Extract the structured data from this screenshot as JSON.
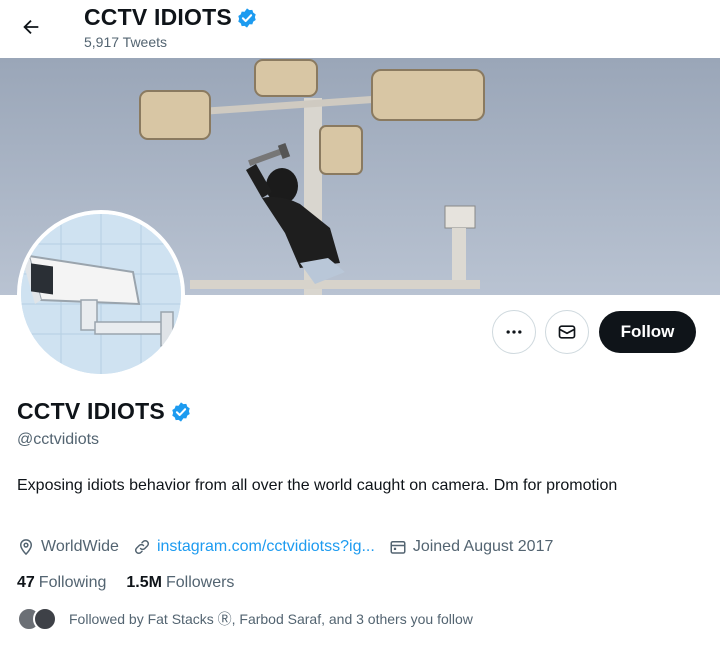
{
  "header": {
    "title": "CCTV IDIOTS",
    "tweets_count": "5,917 Tweets"
  },
  "profile": {
    "name": "CCTV IDIOTS",
    "handle": "@cctvidiots",
    "bio": "Exposing idiots behavior from all over the world caught on camera. Dm for promotion",
    "location": "WorldWide",
    "website": "instagram.com/cctvidiotss?ig...",
    "joined": "Joined August 2017"
  },
  "actions": {
    "follow_label": "Follow"
  },
  "stats": {
    "following_count": "47",
    "following_label": "Following",
    "followers_count": "1.5M",
    "followers_label": "Followers"
  },
  "followed_by": {
    "text": "Followed by Fat Stacks Ⓡ, Farbod Saraf, and 3 others you follow"
  },
  "colors": {
    "verified": "#1d9bf0",
    "link": "#1d9bf0",
    "follow_button_bg": "#0f1419",
    "secondary_text": "#536471"
  }
}
